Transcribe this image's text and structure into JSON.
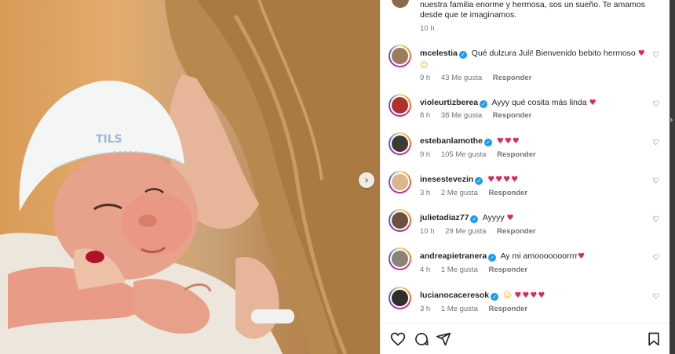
{
  "caption": {
    "text": "nuestra familia enorme y hermosa, sos un sueño. Te amamos desde que te imaginamos.",
    "time": "10 h"
  },
  "comments": [
    {
      "user": "mcelestia",
      "verified": true,
      "text": "Qué dulzura Juli! Bienvenido bebito hermoso",
      "hearts": "♥",
      "extra": "☺",
      "time": "9 h",
      "likes": "43 Me gusta",
      "reply": "Responder",
      "avatar_color": "#9c7b5e"
    },
    {
      "user": "violeurtizberea",
      "verified": true,
      "text": "Ayyy qué cosita más linda",
      "hearts": "♥",
      "time": "8 h",
      "likes": "38 Me gusta",
      "reply": "Responder",
      "avatar_color": "#b0302f"
    },
    {
      "user": "estebanlamothe",
      "verified": true,
      "text": "",
      "hearts": "♥♥♥",
      "time": "9 h",
      "likes": "105 Me gusta",
      "reply": "Responder",
      "avatar_color": "#3d3a34"
    },
    {
      "user": "inesestevezin",
      "verified": true,
      "text": "",
      "hearts": "♥♥♥♥",
      "time": "3 h",
      "likes": "2 Me gusta",
      "reply": "Responder",
      "avatar_color": "#d9b88f"
    },
    {
      "user": "julietadiaz77",
      "verified": true,
      "text": "Ayyyy",
      "hearts": "♥",
      "time": "10 h",
      "likes": "29 Me gusta",
      "reply": "Responder",
      "avatar_color": "#6e5240"
    },
    {
      "user": "andreapietranera",
      "verified": true,
      "text": "Ay mi amooooooorrrr",
      "hearts": "♥",
      "time": "4 h",
      "likes": "1 Me gusta",
      "reply": "Responder",
      "avatar_color": "#8a8478"
    },
    {
      "user": "lucianocaceresok",
      "verified": true,
      "text": "",
      "prefix": "☺",
      "hearts": "♥♥♥♥",
      "time": "3 h",
      "likes": "1 Me gusta",
      "reply": "Responder",
      "avatar_color": "#2f2f2f"
    }
  ],
  "icons": {
    "like": "heart-icon",
    "comment": "comment-icon",
    "share": "share-icon",
    "save": "bookmark-icon",
    "next": "chevron-right-icon"
  },
  "glyphs": {
    "heart_outline": "♡",
    "next": "›",
    "strip_chevron": "›"
  },
  "colors": {
    "verified": "#1d9bf0",
    "heart": "#e0245e",
    "secondary_text": "#737373"
  }
}
